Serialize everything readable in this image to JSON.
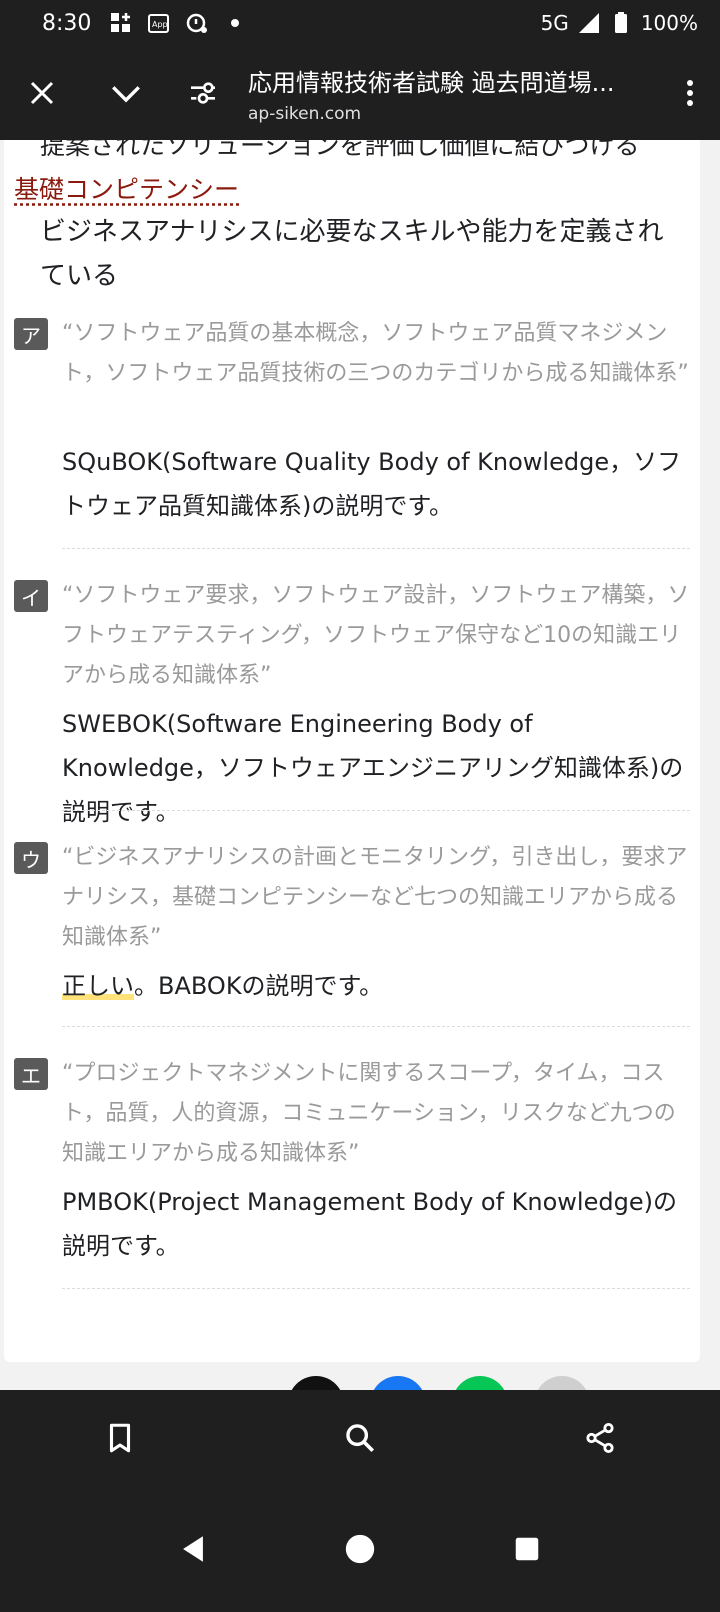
{
  "status_bar": {
    "time": "8:30",
    "network": "5G",
    "battery": "100%",
    "icons": [
      "grid-plus-icon",
      "app-icon",
      "no-sim-icon",
      "dot-icon",
      "signal-icon",
      "battery-icon"
    ]
  },
  "toolbar": {
    "title": "応用情報技術者試験 過去問道場...",
    "url": "ap-siken.com",
    "icons": [
      "close-icon",
      "chevron-down-icon",
      "page-settings-icon",
      "more-vert-icon"
    ]
  },
  "content": {
    "cut_line": "提案されたソリューションを評価し価値に結びつける",
    "section_term": "基礎コンピテンシー",
    "section_desc": "ビジネスアナリシスに必要なスキルや能力を定義されている",
    "choices": [
      {
        "label": "ア",
        "quote": "“ソフトウェア品質の基本概念，ソフトウェア品質マネジメント，ソフトウェア品質技術の三つのカテゴリから成る知識体系”",
        "explanation": "SQuBOK(Software Quality Body of Knowledge，ソフトウェア品質知識体系)の説明です。"
      },
      {
        "label": "イ",
        "quote": "“ソフトウェア要求，ソフトウェア設計，ソフトウェア構築，ソフトウェアテスティング，ソフトウェア保守など10の知識エリアから成る知識体系”",
        "explanation": "SWEBOK(Software Engineering Body of Knowledge，ソフトウェアエンジニアリング知識体系)の説明です。"
      },
      {
        "label": "ウ",
        "quote": "“ビジネスアナリシスの計画とモニタリング，引き出し，要求アナリシス，基礎コンピテンシーなど七つの知識エリアから成る知識体系”",
        "correct_label": "正しい",
        "explanation_rest": "。BABOKの説明です。"
      },
      {
        "label": "エ",
        "quote": "“プロジェクトマネジメントに関するスコープ，タイム，コスト，品質，人的資源，コミュニケーション，リスクなど九つの知識エリアから成る知識体系”",
        "explanation": "PMBOK(Project Management Body of Knowledge)の説明です。"
      }
    ]
  },
  "bottom_bar": {
    "icons": [
      "bookmark-icon",
      "search-icon",
      "share-icon"
    ]
  },
  "nav_bar": {
    "icons": [
      "back-icon",
      "home-icon",
      "recents-icon"
    ]
  },
  "colors": {
    "bar_bg": "#1f1f1f",
    "term_color": "#8b1a0e",
    "badge_bg": "#5a5a5a",
    "quote_color": "#9a9a9a",
    "correct_highlight": "#ffe27a"
  }
}
